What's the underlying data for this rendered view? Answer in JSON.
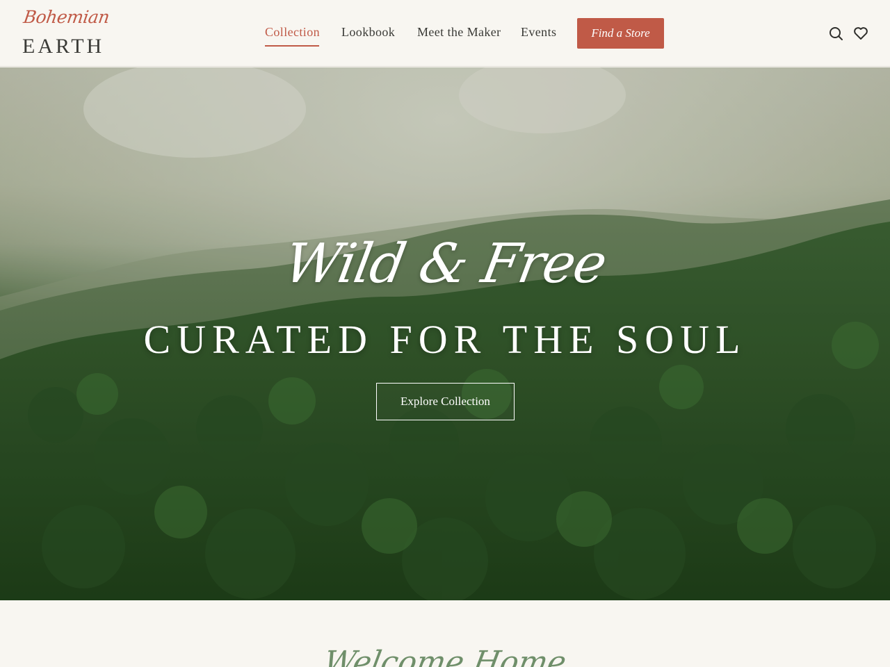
{
  "brand": {
    "script": "Bohemian",
    "name": "EARTH"
  },
  "nav": {
    "items": [
      {
        "label": "Collection",
        "active": true
      },
      {
        "label": "Lookbook",
        "active": false
      },
      {
        "label": "Meet the Maker",
        "active": false
      },
      {
        "label": "Events",
        "active": false
      }
    ],
    "cta_label": "Find a Store"
  },
  "header_icons": [
    "search-icon",
    "heart-icon"
  ],
  "hero": {
    "script_title": "Wild & Free",
    "title": "CURATED FOR THE SOUL",
    "button_label": "Explore Collection"
  },
  "welcome": {
    "script_title": "Welcome Home"
  },
  "colors": {
    "accent": "#c05a47",
    "background": "#f8f6f1",
    "text": "#3a3a36",
    "sage": "#6f8f6a"
  }
}
